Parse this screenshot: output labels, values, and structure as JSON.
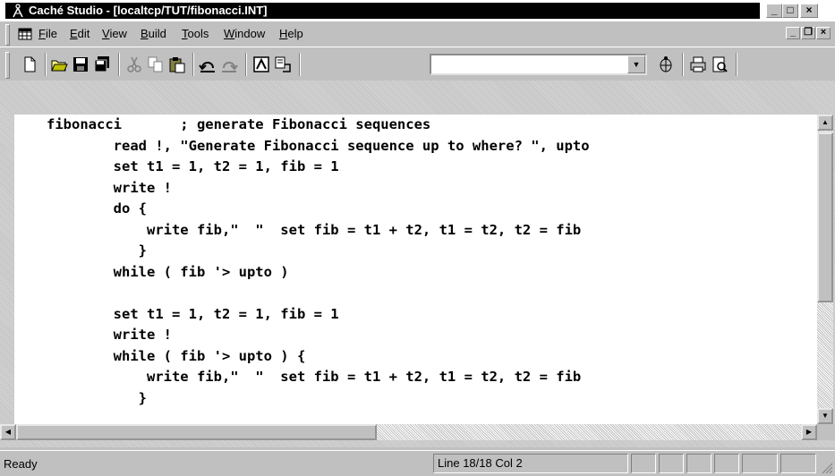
{
  "window": {
    "title": "Caché Studio - [localtcp/TUT/fibonacci.INT]",
    "app_icon": "compass-icon",
    "buttons": [
      "minimize-icon",
      "restore-icon",
      "close-icon"
    ]
  },
  "menubar": {
    "doc_icon": "document-grid-icon",
    "items": [
      {
        "label": "File",
        "underline": "F"
      },
      {
        "label": "Edit",
        "underline": "E"
      },
      {
        "label": "View",
        "underline": "V"
      },
      {
        "label": "Build",
        "underline": "B"
      },
      {
        "label": "Tools",
        "underline": "T"
      },
      {
        "label": "Window",
        "underline": "W"
      },
      {
        "label": "Help",
        "underline": "H"
      }
    ],
    "mdi_buttons": [
      "minimize-icon",
      "restore-icon",
      "close-icon"
    ]
  },
  "toolbar": {
    "buttons": [
      "new-icon",
      "open-icon",
      "save-icon",
      "save-all-icon",
      "cut-icon",
      "copy-icon",
      "paste-icon",
      "undo-icon",
      "redo-icon",
      "view-icon",
      "compile-icon",
      "debug-icon",
      "print-icon",
      "print-preview-icon"
    ],
    "combo_value": ""
  },
  "editor": {
    "lines": [
      "fibonacci       ; generate Fibonacci sequences",
      "        read !, \"Generate Fibonacci sequence up to where? \", upto",
      "        set t1 = 1, t2 = 1, fib = 1",
      "        write !",
      "        do {",
      "            write fib,\"  \"  set fib = t1 + t2, t1 = t2, t2 = fib",
      "           }",
      "        while ( fib '> upto )",
      "",
      "        set t1 = 1, t2 = 1, fib = 1",
      "        write !",
      "        while ( fib '> upto ) {",
      "            write fib,\"  \"  set fib = t1 + t2, t1 = t2, t2 = fib",
      "           }"
    ]
  },
  "statusbar": {
    "status": "Ready",
    "position": "Line 18/18 Col 2"
  }
}
